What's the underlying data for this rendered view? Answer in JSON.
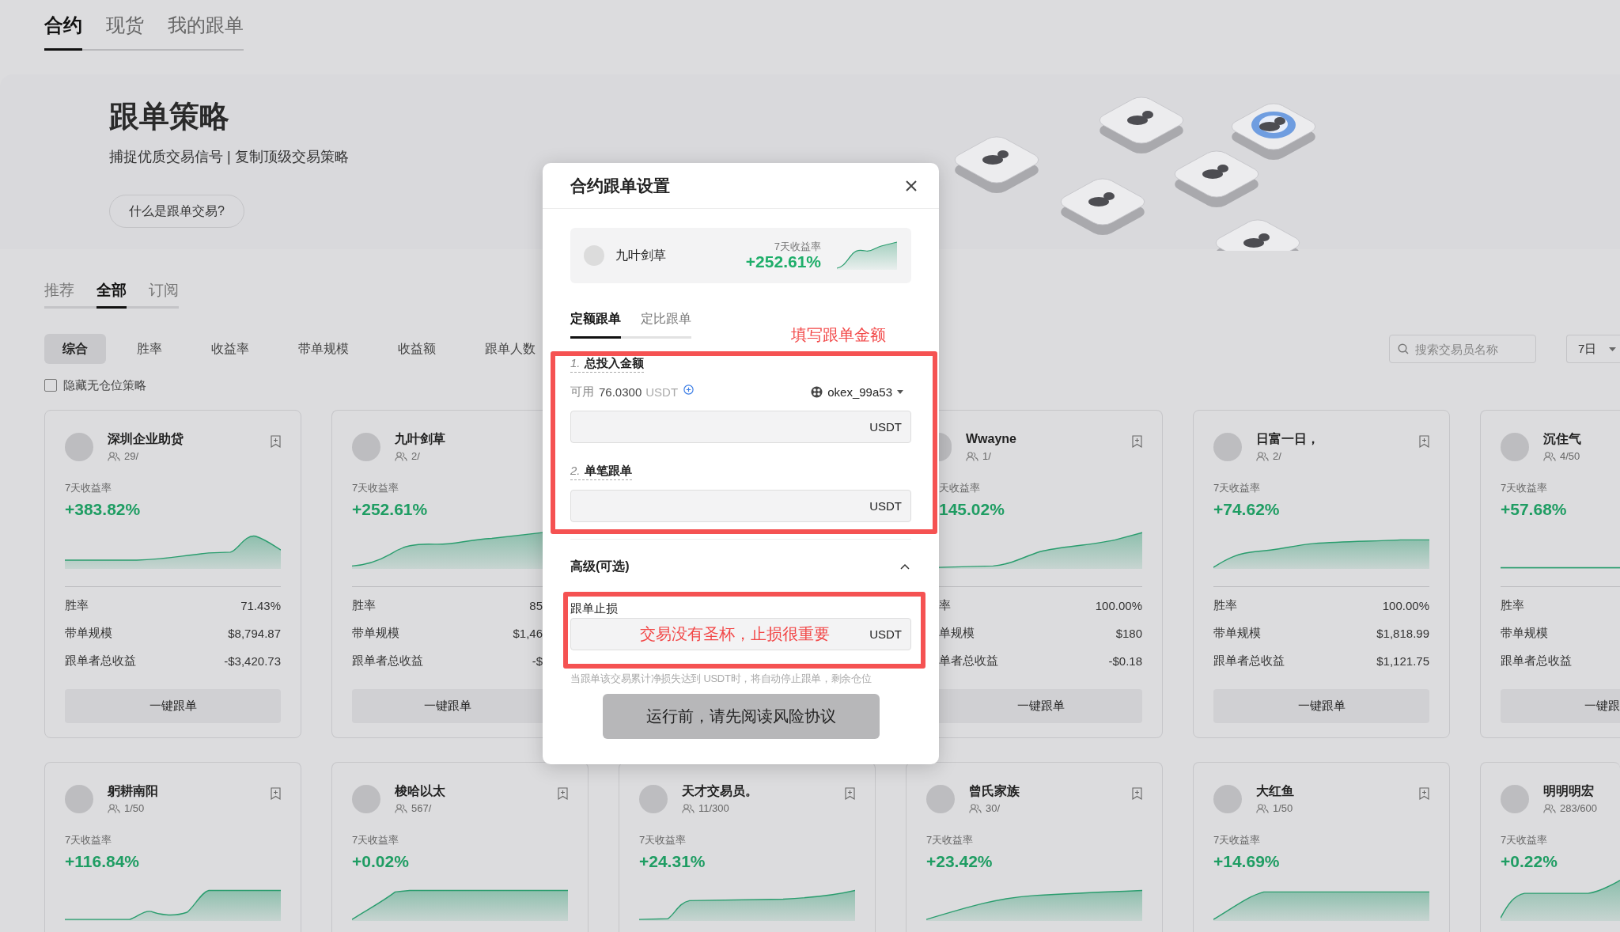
{
  "top_tabs": [
    {
      "label": "合约",
      "selected": true
    },
    {
      "label": "现货",
      "selected": false
    },
    {
      "label": "我的跟单",
      "selected": false
    }
  ],
  "hero": {
    "title": "跟单策略",
    "subtitle": "捕捉优质交易信号 | 复制顶级交易策略",
    "button": "什么是跟单交易?"
  },
  "list_tabs": [
    {
      "label": "推荐",
      "selected": false
    },
    {
      "label": "全部",
      "selected": true
    },
    {
      "label": "订阅",
      "selected": false
    }
  ],
  "sort_chips": [
    {
      "label": "综合",
      "selected": true
    },
    {
      "label": "胜率",
      "selected": false
    },
    {
      "label": "收益率",
      "selected": false
    },
    {
      "label": "带单规模",
      "selected": false
    },
    {
      "label": "收益额",
      "selected": false
    },
    {
      "label": "跟单人数",
      "selected": false
    }
  ],
  "hide_empty": {
    "label": "隐藏无仓位策略",
    "checked": false
  },
  "search": {
    "placeholder": "搜索交易员名称"
  },
  "period": {
    "value": "7日"
  },
  "cards_row_1": [
    {
      "kind": "full",
      "name": "深圳企业助贷",
      "followers": "29/",
      "return_label": "7天收益率",
      "return": "+383.82%",
      "stats": [
        {
          "label": "胜率",
          "value": "71.43%"
        },
        {
          "label": "带单规模",
          "value": "$8,794.87"
        },
        {
          "label": "跟单者总收益",
          "value": "-$3,420.73"
        }
      ],
      "button": "一键跟单"
    },
    {
      "kind": "cut_right",
      "name": "九叶剑草",
      "followers": "2/",
      "return_label": "7天收益率",
      "return": "+252.61%",
      "stats": [
        {
          "label": "胜率",
          "value": "85"
        },
        {
          "label": "带单规模",
          "value": "$1,46"
        },
        {
          "label": "跟单者总收益",
          "value": "-$"
        }
      ],
      "button": "一键跟单"
    },
    {
      "kind": "cut_left",
      "name": "Wwayne",
      "followers": "1/",
      "return_label": "天收益率",
      "return": "145.02%",
      "stats": [
        {
          "label": "率",
          "value": "100.00%"
        },
        {
          "label": "单规模",
          "value": "$180"
        },
        {
          "label": "单者总收益",
          "value": "-$0.18"
        }
      ],
      "button": "一键跟单"
    },
    {
      "kind": "full",
      "name": "日富一日，",
      "followers": "2/",
      "return_label": "7天收益率",
      "return": "+74.62%",
      "stats": [
        {
          "label": "胜率",
          "value": "100.00%"
        },
        {
          "label": "带单规模",
          "value": "$1,818.99"
        },
        {
          "label": "跟单者总收益",
          "value": "$1,121.75"
        }
      ],
      "button": "一键跟单"
    },
    {
      "kind": "edge",
      "name": "沉住气",
      "followers": "4/50",
      "return_label": "7天收益率",
      "return": "+57.68%",
      "stats": [
        {
          "label": "胜率"
        },
        {
          "label": "带单规模"
        },
        {
          "label": "跟单者总收益"
        }
      ],
      "button": "一键跟"
    }
  ],
  "cards_row_2": [
    {
      "kind": "full",
      "name": "躬耕南阳",
      "followers": "1/50",
      "return_label": "7天收益率",
      "return": "+116.84%"
    },
    {
      "kind": "full",
      "name": "梭哈以太",
      "followers": "567/",
      "return_label": "7天收益率",
      "return": "+0.02%"
    },
    {
      "kind": "full",
      "name": "天才交易员。",
      "followers": "11/300",
      "return_label": "7天收益率",
      "return": "+24.31%"
    },
    {
      "kind": "full",
      "name": "曾氏家族",
      "followers": "30/",
      "return_label": "7天收益率",
      "return": "+23.42%"
    },
    {
      "kind": "full",
      "name": "大红鱼",
      "followers": "1/50",
      "return_label": "7天收益率",
      "return": "+14.69%"
    },
    {
      "kind": "edge",
      "name": "明明明宏",
      "followers": "283/600",
      "return_label": "7天收益率",
      "return": "+0.22%"
    }
  ],
  "modal": {
    "title": "合约跟单设置",
    "trader": {
      "name": "九叶剑草",
      "return_label": "7天收益率",
      "return": "+252.61%"
    },
    "tabs": [
      {
        "label": "定额跟单",
        "selected": true
      },
      {
        "label": "定比跟单",
        "selected": false
      }
    ],
    "annotation": "填写跟单金额",
    "total": {
      "index": "1.",
      "label": "总投入金额",
      "available_label": "可用",
      "available": "76.0300",
      "available_unit": "USDT",
      "account": "okex_99a53",
      "unit": "USDT"
    },
    "single": {
      "index": "2.",
      "label": "单笔跟单",
      "unit": "USDT"
    },
    "advanced": {
      "label": "高级(可选)",
      "expanded": true
    },
    "stop_loss": {
      "label": "跟单止损",
      "annotation": "交易没有圣杯，止损很重要",
      "unit": "USDT",
      "hint": "当跟单该交易累计净损失达到 USDT时，将自动停止跟单，剩余仓位"
    },
    "submit": "运行前，请先阅读风险协议"
  }
}
